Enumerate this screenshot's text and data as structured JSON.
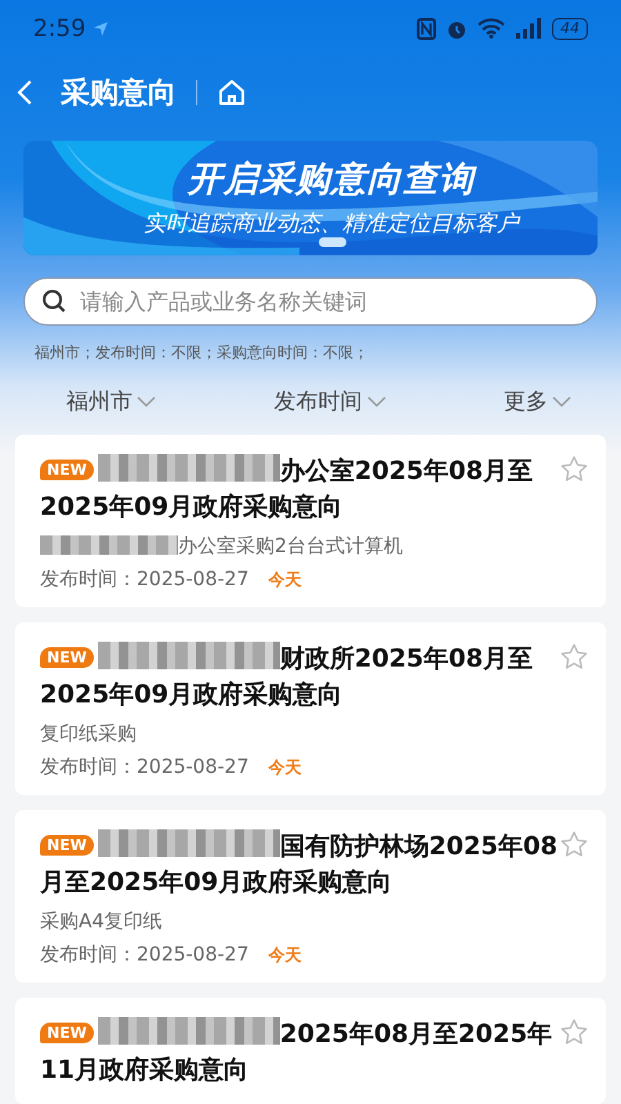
{
  "status_bar": {
    "time": "2:59",
    "battery": "44"
  },
  "header": {
    "title": "采购意向"
  },
  "banner": {
    "title": "开启采购意向查询",
    "subtitle": "实时追踪商业动态、精准定位目标客户"
  },
  "search": {
    "placeholder": "请输入产品或业务名称关键词"
  },
  "filter_summary": "福州市；发布时间：不限；采购意向时间：不限；",
  "filters": [
    {
      "label": "福州市"
    },
    {
      "label": "发布时间"
    },
    {
      "label": "更多"
    }
  ],
  "cards": [
    {
      "new": true,
      "badge": "NEW",
      "title_redacted": true,
      "title": "办公室2025年08月至2025年09月政府采购意向",
      "subtitle_redacted": true,
      "subtitle": "办公室采购2台台式计算机",
      "date_label": "发布时间：",
      "date": "2025-08-27",
      "tag": "今天",
      "starred": false
    },
    {
      "new": true,
      "badge": "NEW",
      "title_redacted": true,
      "title": "财政所2025年08月至2025年09月政府采购意向",
      "subtitle_redacted": false,
      "subtitle": "复印纸采购",
      "date_label": "发布时间：",
      "date": "2025-08-27",
      "tag": "今天",
      "starred": false
    },
    {
      "new": true,
      "badge": "NEW",
      "title_redacted": true,
      "title": "国有防护林场2025年08月至2025年09月政府采购意向",
      "subtitle_redacted": false,
      "subtitle": "采购A4复印纸",
      "date_label": "发布时间：",
      "date": "2025-08-27",
      "tag": "今天",
      "starred": false
    },
    {
      "new": true,
      "badge": "NEW",
      "title_redacted": true,
      "title": "2025年08月至2025年11月政府采购意向",
      "starred": false
    }
  ]
}
